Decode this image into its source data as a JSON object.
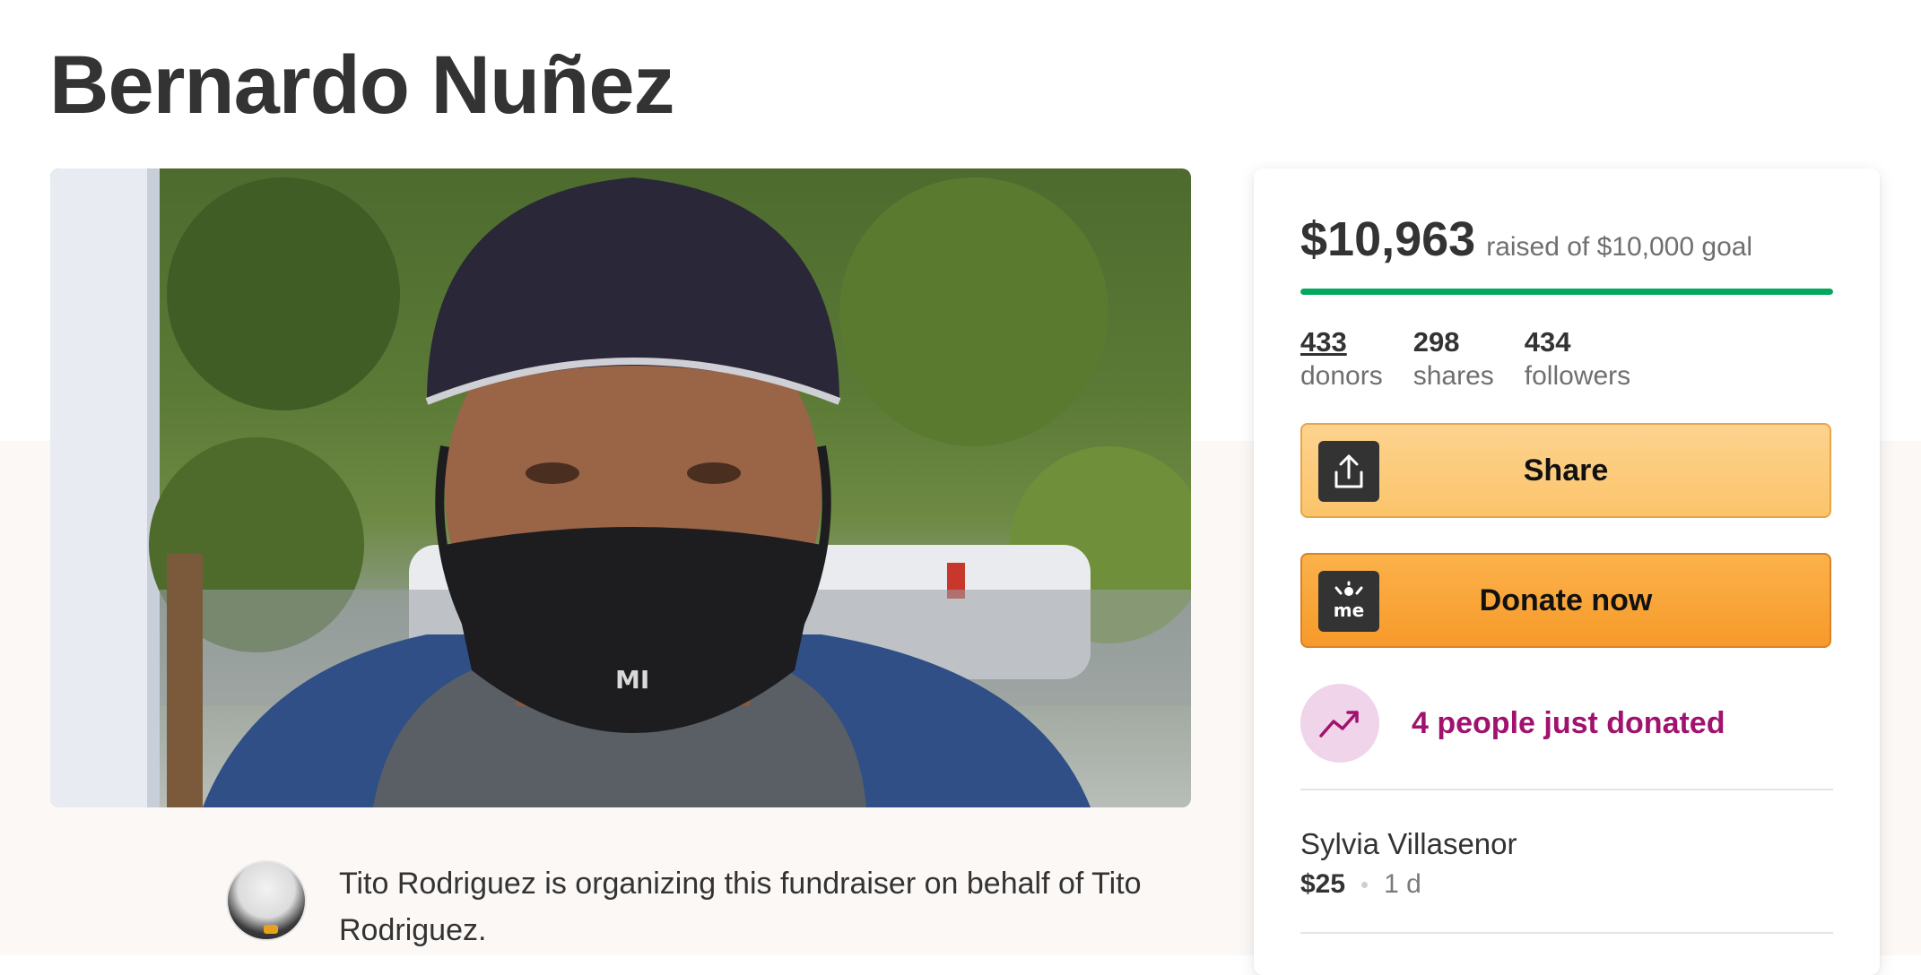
{
  "campaign": {
    "title": "Bernardo Nuñez"
  },
  "organizer": {
    "text": "Tito Rodriguez is organizing this fundraiser on behalf of Tito Rodriguez."
  },
  "donation_card": {
    "raised_amount": "$10,963",
    "goal_text": "raised of $10,000 goal",
    "progress_fraction": 1.0,
    "stats": [
      {
        "value": "433",
        "label": "donors"
      },
      {
        "value": "298",
        "label": "shares"
      },
      {
        "value": "434",
        "label": "followers"
      }
    ],
    "share_label": "Share",
    "donate_label": "Donate now",
    "donate_icon_text": "me",
    "recent_activity": "4 people just donated",
    "recent_donor": {
      "name": "Sylvia Villasenor",
      "amount": "$25",
      "time": "1 d"
    }
  },
  "colors": {
    "progress": "#02a95c",
    "activity_text": "#a0126e",
    "donate_button": "#f79a2a",
    "share_button": "#fbc46a"
  },
  "icons": {
    "share": "share-upload-icon",
    "donate": "gofundme-logo-icon",
    "trend": "trending-up-icon"
  }
}
